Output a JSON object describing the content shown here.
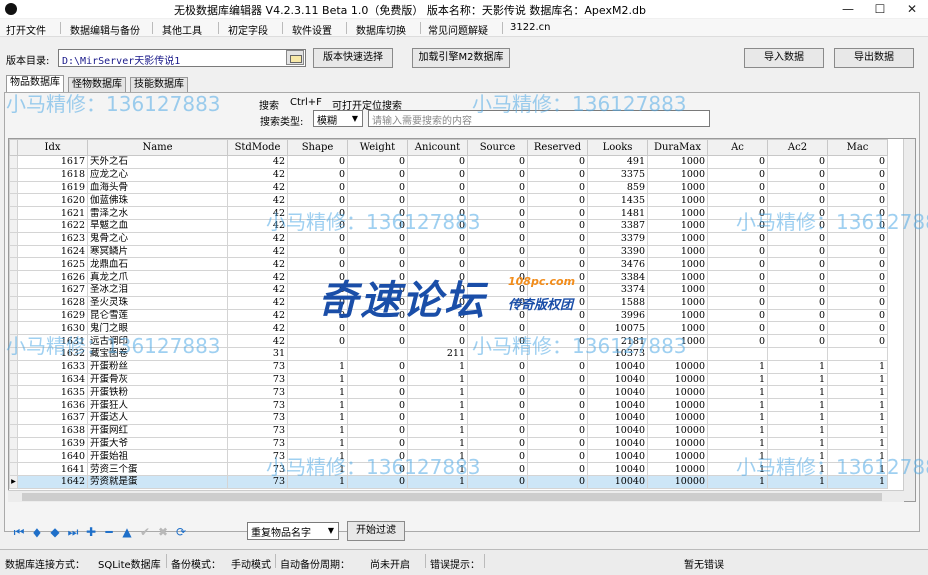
{
  "window": {
    "title": "无极数据库编辑器 V4.2.3.11    Beta 1.0（免费版）    版本名称：天影传说    数据库名：ApexM2.db",
    "minimize": "—",
    "maximize": "☐",
    "close": "✕"
  },
  "menu": [
    "打开文件",
    "数据编辑与备份",
    "其他工具",
    "初定字段",
    "软件设置",
    "数据库切换",
    "常见问题解疑",
    "3122.cn"
  ],
  "toolbar": {
    "dir_label": "版本目录:",
    "dir_value": "D:\\MirServer天影传说1",
    "quick_select": "版本快速选择",
    "load_engine": "加载引擎M2数据库",
    "import": "导入数据",
    "export": "导出数据"
  },
  "tabs": [
    "物品数据库",
    "怪物数据库",
    "技能数据库"
  ],
  "search": {
    "hint_prefix": "搜索",
    "hint_keys": "Ctrl+F",
    "hint_suffix": "可打开定位搜索",
    "type_label": "搜索类型:",
    "type_value": "模糊",
    "placeholder": "请输入需要搜索的内容"
  },
  "grid": {
    "columns": [
      "Idx",
      "Name",
      "StdMode",
      "Shape",
      "Weight",
      "Anicount",
      "Source",
      "Reserved",
      "Looks",
      "DuraMax",
      "Ac",
      "Ac2",
      "Mac"
    ],
    "rows": [
      [
        "1617",
        "天外之石",
        "42",
        "0",
        "0",
        "0",
        "0",
        "0",
        "491",
        "1000",
        "0",
        "0",
        "0"
      ],
      [
        "1618",
        "应龙之心",
        "42",
        "0",
        "0",
        "0",
        "0",
        "0",
        "3375",
        "1000",
        "0",
        "0",
        "0"
      ],
      [
        "1619",
        "血海头骨",
        "42",
        "0",
        "0",
        "0",
        "0",
        "0",
        "859",
        "1000",
        "0",
        "0",
        "0"
      ],
      [
        "1620",
        "伽蓝佛珠",
        "42",
        "0",
        "0",
        "0",
        "0",
        "0",
        "1435",
        "1000",
        "0",
        "0",
        "0"
      ],
      [
        "1621",
        "雷泽之水",
        "42",
        "0",
        "0",
        "0",
        "0",
        "0",
        "1481",
        "1000",
        "0",
        "0",
        "0"
      ],
      [
        "1622",
        "旱魃之血",
        "42",
        "0",
        "0",
        "0",
        "0",
        "0",
        "3387",
        "1000",
        "0",
        "0",
        "0"
      ],
      [
        "1623",
        "鬼骨之心",
        "42",
        "0",
        "0",
        "0",
        "0",
        "0",
        "3379",
        "1000",
        "0",
        "0",
        "0"
      ],
      [
        "1624",
        "寒冥鳞片",
        "42",
        "0",
        "0",
        "0",
        "0",
        "0",
        "3390",
        "1000",
        "0",
        "0",
        "0"
      ],
      [
        "1625",
        "龙鼎血石",
        "42",
        "0",
        "0",
        "0",
        "0",
        "0",
        "3476",
        "1000",
        "0",
        "0",
        "0"
      ],
      [
        "1626",
        "真龙之爪",
        "42",
        "0",
        "0",
        "0",
        "0",
        "0",
        "3384",
        "1000",
        "0",
        "0",
        "0"
      ],
      [
        "1627",
        "圣冰之泪",
        "42",
        "0",
        "0",
        "0",
        "0",
        "0",
        "3374",
        "1000",
        "0",
        "0",
        "0"
      ],
      [
        "1628",
        "圣火灵珠",
        "42",
        "0",
        "0",
        "0",
        "0",
        "0",
        "1588",
        "1000",
        "0",
        "0",
        "0"
      ],
      [
        "1629",
        "昆仑雪莲",
        "42",
        "0",
        "0",
        "0",
        "0",
        "0",
        "3996",
        "1000",
        "0",
        "0",
        "0"
      ],
      [
        "1630",
        "鬼门之眼",
        "42",
        "0",
        "0",
        "0",
        "0",
        "0",
        "10075",
        "1000",
        "0",
        "0",
        "0"
      ],
      [
        "1631",
        "远古调印",
        "42",
        "0",
        "0",
        "0",
        "0",
        "0",
        "2181",
        "1000",
        "0",
        "0",
        "0"
      ],
      [
        "1632",
        "藏宝图卷",
        "31",
        "",
        "",
        "211",
        "",
        "",
        "10373",
        "",
        "",
        "",
        ""
      ],
      [
        "1633",
        "开蛋粉丝",
        "73",
        "1",
        "0",
        "1",
        "0",
        "0",
        "10040",
        "10000",
        "1",
        "1",
        "1"
      ],
      [
        "1634",
        "开蛋骨灰",
        "73",
        "1",
        "0",
        "1",
        "0",
        "0",
        "10040",
        "10000",
        "1",
        "1",
        "1"
      ],
      [
        "1635",
        "开蛋铁粉",
        "73",
        "1",
        "0",
        "1",
        "0",
        "0",
        "10040",
        "10000",
        "1",
        "1",
        "1"
      ],
      [
        "1636",
        "开蛋狂人",
        "73",
        "1",
        "0",
        "1",
        "0",
        "0",
        "10040",
        "10000",
        "1",
        "1",
        "1"
      ],
      [
        "1637",
        "开蛋达人",
        "73",
        "1",
        "0",
        "1",
        "0",
        "0",
        "10040",
        "10000",
        "1",
        "1",
        "1"
      ],
      [
        "1638",
        "开蛋网红",
        "73",
        "1",
        "0",
        "1",
        "0",
        "0",
        "10040",
        "10000",
        "1",
        "1",
        "1"
      ],
      [
        "1639",
        "开蛋大爷",
        "73",
        "1",
        "0",
        "1",
        "0",
        "0",
        "10040",
        "10000",
        "1",
        "1",
        "1"
      ],
      [
        "1640",
        "开蛋始祖",
        "73",
        "1",
        "0",
        "1",
        "0",
        "0",
        "10040",
        "10000",
        "1",
        "1",
        "1"
      ],
      [
        "1641",
        "劳资三个蛋",
        "73",
        "1",
        "0",
        "1",
        "0",
        "0",
        "10040",
        "10000",
        "1",
        "1",
        "1"
      ],
      [
        "1642",
        "劳资就是蛋",
        "73",
        "1",
        "0",
        "1",
        "0",
        "0",
        "10040",
        "10000",
        "1",
        "1",
        "1"
      ]
    ],
    "selected_row": 25,
    "row_marker": "▸"
  },
  "nav": {
    "icons": [
      {
        "name": "first-record-icon",
        "glyph": "⏮",
        "enabled": true
      },
      {
        "name": "prev-page-icon",
        "glyph": "◆",
        "enabled": true
      },
      {
        "name": "next-page-icon",
        "glyph": "◆",
        "enabled": true
      },
      {
        "name": "last-record-icon",
        "glyph": "⏭",
        "enabled": true
      },
      {
        "name": "add-record-icon",
        "glyph": "✚",
        "enabled": true
      },
      {
        "name": "delete-record-icon",
        "glyph": "━",
        "enabled": true
      },
      {
        "name": "edit-record-icon",
        "glyph": "▲",
        "enabled": true
      },
      {
        "name": "post-record-icon",
        "glyph": "✔",
        "enabled": false
      },
      {
        "name": "cancel-edit-icon",
        "glyph": "✖",
        "enabled": false
      },
      {
        "name": "refresh-icon",
        "glyph": "⟳",
        "enabled": true
      }
    ],
    "dedupe_select": "重复物品名字",
    "filter_button": "开始过滤"
  },
  "status": {
    "conn_label": "数据库连接方式：",
    "conn_value": "SQLite数据库",
    "backup_label": "备份模式：",
    "backup_value": "手动模式",
    "auto_label": "自动备份周期：",
    "auto_value": "尚未开启",
    "error_label": "错误提示：",
    "error_value": "暂无错误"
  },
  "watermarks": {
    "phone_text": "小马精修：136127883",
    "logo_main": "奇速论坛",
    "logo_url": "108pc.com",
    "logo_sub": "传奇版权团"
  },
  "colors": {
    "accent": "#1e6fc9",
    "selection": "#cde6f7",
    "watermark": "#50aae6",
    "logo_blue": "#1a4ea8",
    "logo_orange": "#f28c1a"
  }
}
